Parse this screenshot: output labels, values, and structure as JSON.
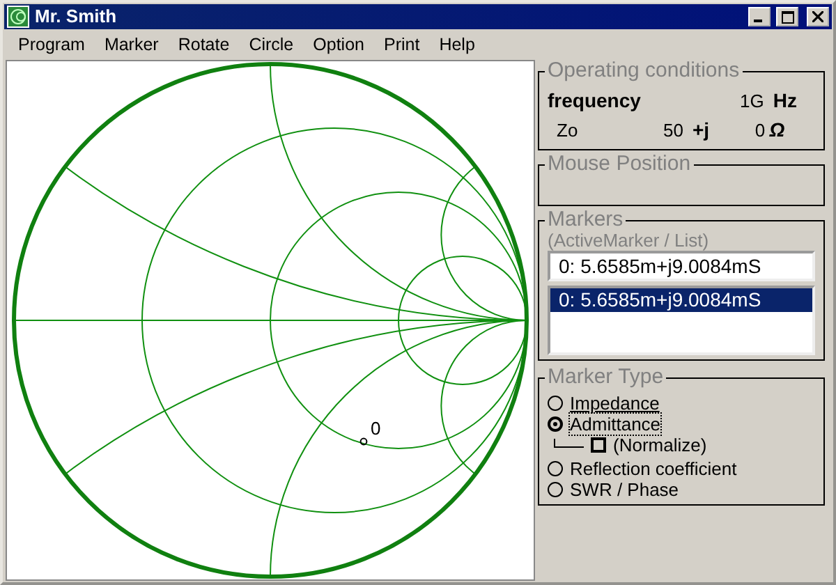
{
  "window": {
    "title": "Mr. Smith"
  },
  "menu": [
    "Program",
    "Marker",
    "Rotate",
    "Circle",
    "Option",
    "Print",
    "Help"
  ],
  "chart": {
    "marker_label": "0"
  },
  "operating_conditions": {
    "title": "Operating conditions",
    "frequency_label": "frequency",
    "frequency_value": "1G",
    "frequency_unit": "Hz",
    "zo_label": "Zo",
    "zo_real": "50",
    "zo_j": "+j",
    "zo_imag": "0",
    "zo_unit": "Ω"
  },
  "mouse_position": {
    "title": "Mouse Position"
  },
  "markers": {
    "title": "Markers",
    "subtitle": "(ActiveMarker / List)",
    "active_marker": "0: 5.6585m+j9.0084mS",
    "list": [
      {
        "text": "0: 5.6585m+j9.0084mS",
        "selected": true
      }
    ]
  },
  "marker_type": {
    "title": "Marker Type",
    "options": [
      {
        "kind": "radio",
        "label": "Impedance",
        "selected": false,
        "focused": false
      },
      {
        "kind": "radio",
        "label": "Admittance",
        "selected": true,
        "focused": true
      },
      {
        "kind": "checkbox",
        "label": "(Normalize)",
        "checked": false
      },
      {
        "kind": "radio",
        "label": "Reflection coefficient",
        "selected": false,
        "focused": false
      },
      {
        "kind": "radio",
        "label": "SWR / Phase",
        "selected": false,
        "focused": false
      }
    ]
  }
}
